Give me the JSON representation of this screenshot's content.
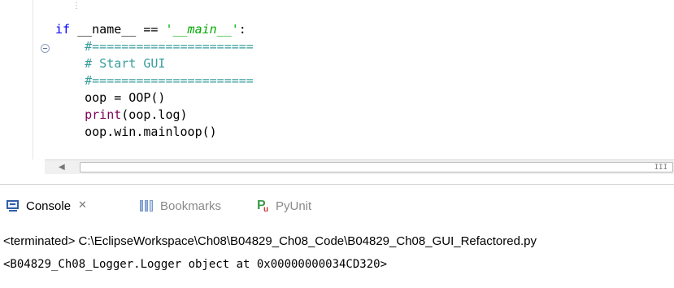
{
  "editor": {
    "code_lines": [
      {
        "segments": [
          {
            "text": "if",
            "cls": "kw"
          },
          {
            "text": " __name__ == ",
            "cls": "op"
          },
          {
            "text": "'__main__'",
            "cls": "str"
          },
          {
            "text": ":",
            "cls": "op"
          }
        ]
      },
      {
        "segments": [
          {
            "text": "    #======================",
            "cls": "cmt"
          }
        ]
      },
      {
        "segments": [
          {
            "text": "    # Start GUI",
            "cls": "cmt"
          }
        ]
      },
      {
        "segments": [
          {
            "text": "    #======================",
            "cls": "cmt"
          }
        ]
      },
      {
        "segments": [
          {
            "text": "    oop = OOP()",
            "cls": "op"
          }
        ]
      },
      {
        "segments": [
          {
            "text": "    ",
            "cls": "op"
          },
          {
            "text": "print",
            "cls": "fn"
          },
          {
            "text": "(oop.log)",
            "cls": "op"
          }
        ]
      },
      {
        "segments": [
          {
            "text": "    oop.win.mainloop()",
            "cls": "op"
          }
        ]
      }
    ]
  },
  "scrollbar": {
    "left_arrow": "◀",
    "grip": "III"
  },
  "tabs": {
    "console_label": "Console",
    "console_close": "✕",
    "bookmarks_label": "Bookmarks",
    "pyunit_label": "PyUnit",
    "pyunit_icon_p": "P",
    "pyunit_icon_u": "u"
  },
  "console": {
    "terminated_line": "<terminated> C:\\EclipseWorkspace\\Ch08\\B04829_Ch08_Code\\B04829_Ch08_GUI_Refactored.py",
    "output_line": "<B04829_Ch08_Logger.Logger object at 0x00000000034CD320>"
  },
  "colors": {
    "keyword": "#0000ff",
    "string": "#00aa00",
    "comment": "#3a9c9c",
    "builtin": "#7f0055"
  }
}
